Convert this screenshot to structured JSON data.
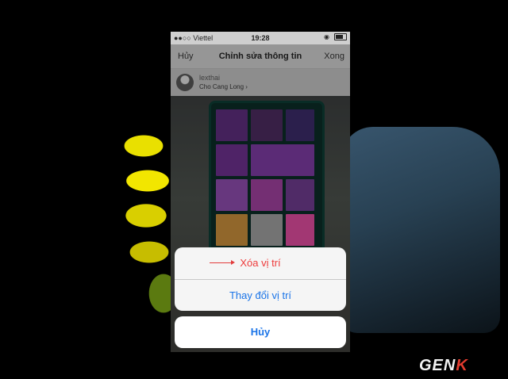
{
  "status_bar": {
    "carrier": "●●○○ Viettel",
    "time": "19:28"
  },
  "nav_bar": {
    "cancel_label": "Hủy",
    "title": "Chỉnh sửa thông tin",
    "done_label": "Xong"
  },
  "post": {
    "username": "lexthai",
    "location": "Cho Cang Long ›"
  },
  "action_sheet": {
    "delete_location_label": "Xóa vị trí",
    "change_location_label": "Thay đổi vị trí",
    "cancel_label": "Hủy"
  },
  "watermark": {
    "prefix": "GEN",
    "suffix": "K"
  },
  "colors": {
    "action_blue": "#1a74e8",
    "destructive_red": "#ee3b3b"
  }
}
